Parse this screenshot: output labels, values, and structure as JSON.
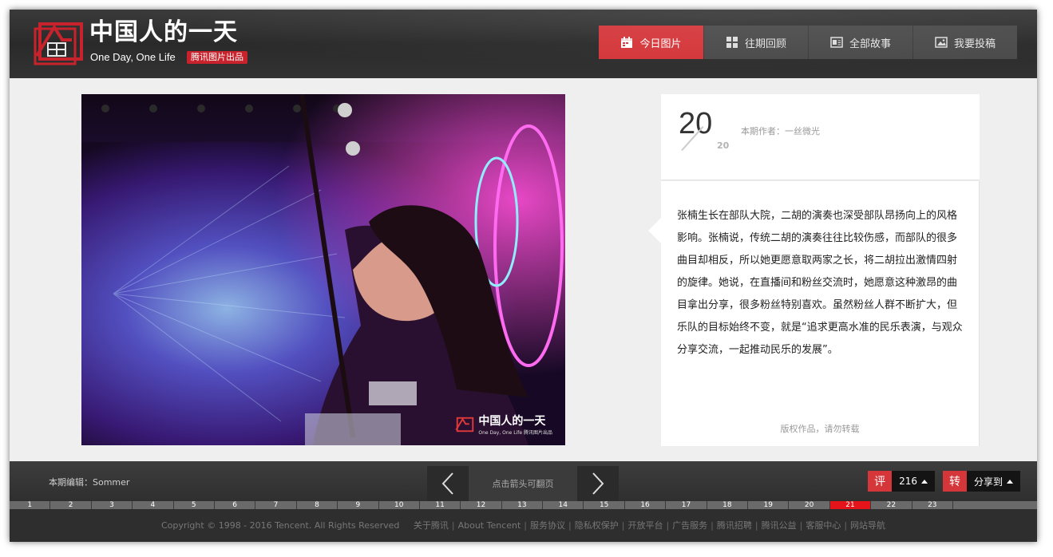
{
  "header": {
    "title": "中国人的一天",
    "subtitle": "One Day, One Life",
    "badge": "腾讯图片出品"
  },
  "nav": [
    {
      "label": "今日图片",
      "icon": "calendar-icon",
      "active": true
    },
    {
      "label": "往期回顾",
      "icon": "grid-icon",
      "active": false
    },
    {
      "label": "全部故事",
      "icon": "story-icon",
      "active": false
    },
    {
      "label": "我要投稿",
      "icon": "image-icon",
      "active": false
    }
  ],
  "photo": {
    "watermark_title": "中国人的一天",
    "watermark_sub": "One Day, One Life 腾讯图片出品"
  },
  "article": {
    "page_current": "20",
    "page_total": "20",
    "author": "本期作者：一丝微光",
    "description": "张楠生长在部队大院，二胡的演奏也深受部队昂扬向上的风格影响。张楠说，传统二胡的演奏往往比较伤感，而部队的很多曲目却相反，所以她更愿意取两家之长，将二胡拉出激情四射的旋律。她说，在直播间和粉丝交流时，她愿意这种激昂的曲目拿出分享，很多粉丝特别喜欢。虽然粉丝人群不断扩大，但乐队的目标始终不变，就是“追求更高水准的民乐表演，与观众分享交流，一起推动民乐的发展”。",
    "copyright": "版权作品，请勿转载"
  },
  "footer": {
    "editor": "本期编辑：Sommer",
    "pager_hint": "点击箭头可翻页",
    "comment_key": "评",
    "comment_count": "216",
    "share_key": "转",
    "share_label": "分享到",
    "timeline": [
      "1",
      "2",
      "3",
      "4",
      "5",
      "6",
      "7",
      "8",
      "9",
      "10",
      "11",
      "12",
      "13",
      "14",
      "15",
      "16",
      "17",
      "18",
      "19",
      "20",
      "21",
      "22",
      "23"
    ],
    "timeline_active": "21",
    "copyright": "Copyright © 1998 - 2016 Tencent. All Rights Reserved",
    "links": [
      "关于腾讯",
      "About Tencent",
      "服务协议",
      "隐私权保护",
      "开放平台",
      "广告服务",
      "腾讯招聘",
      "腾讯公益",
      "客服中心",
      "网站导航"
    ]
  },
  "colors": {
    "accent": "#d4363a",
    "timeline_active": "#e5141b"
  }
}
